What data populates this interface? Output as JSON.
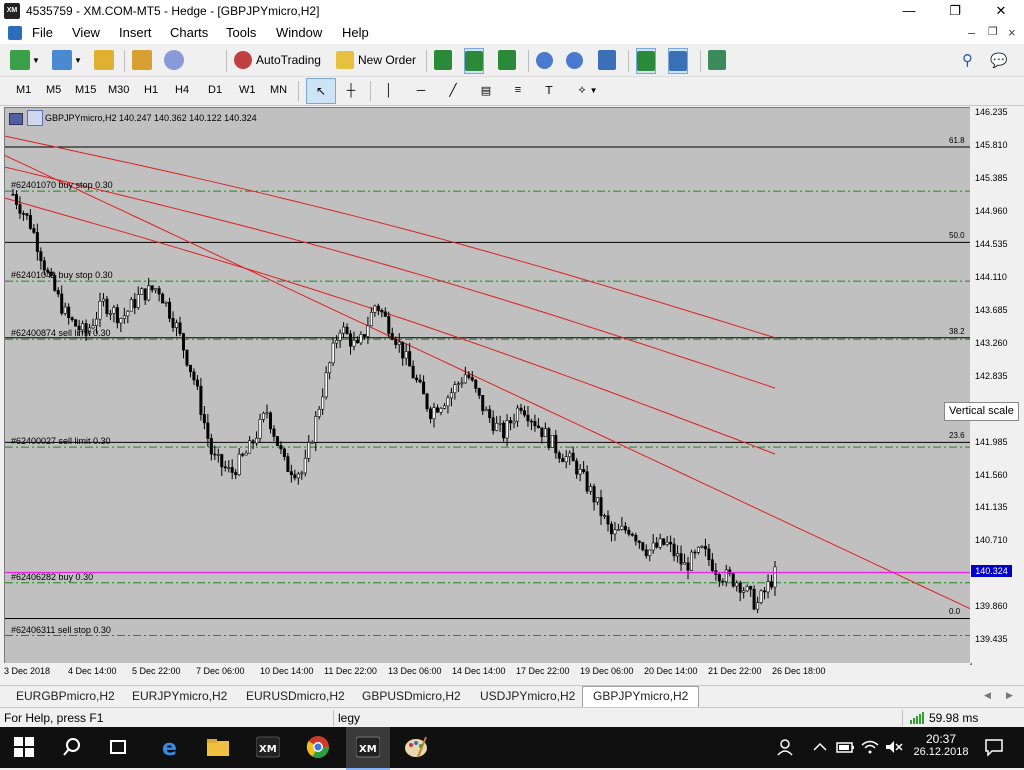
{
  "window": {
    "title": "4535759 - XM.COM-MT5 - Hedge - [GBPJPYmicro,H2]",
    "app_icon_text": "XM",
    "minimize": "—",
    "maximize": "❐",
    "close": "✕"
  },
  "menu": [
    "File",
    "View",
    "Insert",
    "Charts",
    "Tools",
    "Window",
    "Help"
  ],
  "toolbar": {
    "autotrading_label": "AutoTrading",
    "new_order_label": "New Order"
  },
  "timeframes": [
    "M1",
    "M5",
    "M15",
    "M30",
    "H1",
    "H4",
    "D1",
    "W1",
    "MN"
  ],
  "chart": {
    "header": "GBPJPYmicro,H2  140.247 140.362 140.122 140.324",
    "current_price": "140.324",
    "vertical_scale_tooltip": "Vertical scale",
    "price_ticks": [
      "146.235",
      "145.810",
      "145.385",
      "144.960",
      "144.535",
      "144.110",
      "143.685",
      "143.260",
      "142.835",
      "142.410",
      "141.985",
      "141.560",
      "141.135",
      "140.710",
      "140.285",
      "139.860",
      "139.435"
    ],
    "time_ticks": [
      "3 Dec 2018",
      "4 Dec 14:00",
      "5 Dec 22:00",
      "7 Dec 06:00",
      "10 Dec 14:00",
      "11 Dec 22:00",
      "13 Dec 06:00",
      "14 Dec 14:00",
      "17 Dec 22:00",
      "19 Dec 06:00",
      "20 Dec 14:00",
      "21 Dec 22:00",
      "26 Dec 18:00"
    ],
    "fib_levels": [
      {
        "label": "61.8",
        "price": 145.81
      },
      {
        "label": "50.0",
        "price": 144.58
      },
      {
        "label": "38.2",
        "price": 143.35
      },
      {
        "label": "23.6",
        "price": 142.0
      },
      {
        "label": "0.0",
        "price": 139.73
      }
    ],
    "orders": [
      {
        "label": "#62401070 buy stop 0.30",
        "price": 145.24
      },
      {
        "label": "#62401041 buy stop 0.30",
        "price": 144.08
      },
      {
        "label": "#62400874 sell limit 0.30",
        "price": 143.33
      },
      {
        "label": "#62400027 sell limit 0.30",
        "price": 141.94
      },
      {
        "label": "#62406282 buy 0.30",
        "price": 140.19
      },
      {
        "label": "#62406311 sell stop 0.30",
        "price": 139.51
      }
    ]
  },
  "chart_data": {
    "type": "candlestick",
    "symbol": "GBPJPYmicro",
    "timeframe": "H2",
    "ylim": [
      139.22,
      146.235
    ],
    "open": 140.247,
    "high": 140.362,
    "low": 140.122,
    "close": 140.324,
    "series_path": [
      145.2,
      144.8,
      144.1,
      143.6,
      143.4,
      143.8,
      143.6,
      143.9,
      144.0,
      143.5,
      142.8,
      141.8,
      141.6,
      141.9,
      142.4,
      141.7,
      141.6,
      142.6,
      143.5,
      143.2,
      143.8,
      143.4,
      142.9,
      142.4,
      142.6,
      142.9,
      142.4,
      142.1,
      142.5,
      142.2,
      141.9,
      141.7,
      141.3,
      140.8,
      140.9,
      140.6,
      140.7,
      140.4,
      140.6,
      140.3,
      140.2,
      139.9,
      140.3
    ],
    "moving_averages": [
      {
        "color": "#e02020",
        "from": 145.95,
        "to": 143.35
      },
      {
        "color": "#e02020",
        "from": 145.55,
        "to": 142.7
      },
      {
        "color": "#e02020",
        "from": 145.15,
        "to": 141.85
      },
      {
        "color": "#e02020",
        "from": 145.7,
        "to": 139.85
      }
    ]
  },
  "tabs": [
    "EURGBPmicro,H2",
    "EURJPYmicro,H2",
    "EURUSDmicro,H2",
    "GBPUSDmicro,H2",
    "USDJPYmicro,H2",
    "GBPJPYmicro,H2"
  ],
  "active_tab": "GBPJPYmicro,H2",
  "status": {
    "help": "For Help, press F1",
    "profile": "legy",
    "ping": "59.98 ms"
  },
  "taskbar": {
    "time": "20:37",
    "date": "26.12.2018"
  },
  "colors": {
    "chart_bg": "#c0c0c0",
    "ma_color": "#e02020",
    "order_line": "#1a8a1a",
    "bid_line": "#ff00ff",
    "price_tag": "#0000c8"
  }
}
